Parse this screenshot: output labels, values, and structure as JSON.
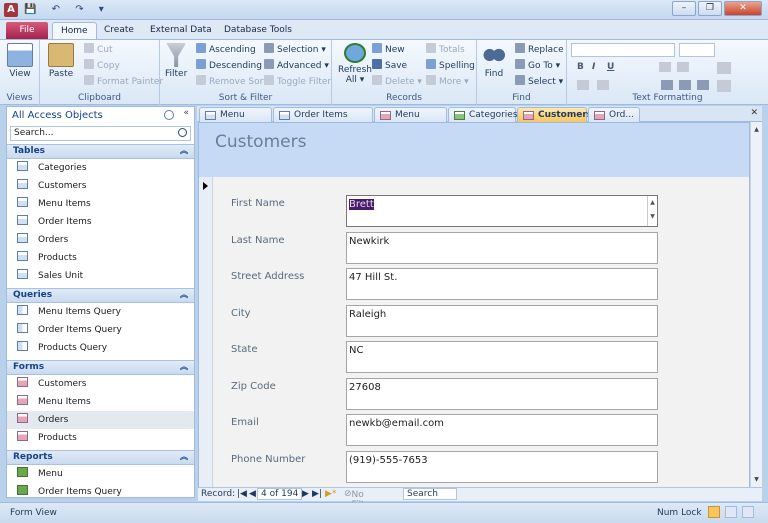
{
  "window": {
    "app_letter": "A",
    "quick_access": "💾 ↶ ↷ ▾",
    "controls": [
      "–",
      "❐",
      "✕"
    ]
  },
  "ribbon_tabs": {
    "file": "File",
    "tabs": [
      "Home",
      "Create",
      "External Data",
      "Database Tools"
    ]
  },
  "ribbon": {
    "views": {
      "view": "View",
      "group": "Views"
    },
    "clipboard": {
      "paste": "Paste",
      "cut": "Cut",
      "copy": "Copy",
      "format_painter": "Format Painter",
      "group": "Clipboard"
    },
    "sort_filter": {
      "filter": "Filter",
      "ascending": "Ascending",
      "descending": "Descending",
      "remove_sort": "Remove Sort",
      "selection": "Selection ▾",
      "advanced": "Advanced ▾",
      "toggle_filter": "Toggle Filter",
      "group": "Sort & Filter"
    },
    "records": {
      "refresh": "Refresh",
      "refresh_all": "All ▾",
      "new": "New",
      "save": "Save",
      "delete": "Delete ▾",
      "totals": "Totals",
      "spelling": "Spelling",
      "more": "More ▾",
      "group": "Records"
    },
    "find": {
      "find": "Find",
      "replace": "Replace",
      "go_to": "Go To ▾",
      "select": "Select ▾",
      "group": "Find"
    },
    "text_formatting": {
      "group": "Text Formatting",
      "bold": "B",
      "italic": "I",
      "underline": "U"
    }
  },
  "nav_pane": {
    "title": "All Access Objects",
    "search_placeholder": "Search...",
    "sections": [
      {
        "name": "Tables",
        "items": [
          "Categories",
          "Customers",
          "Menu Items",
          "Order Items",
          "Orders",
          "Products",
          "Sales Unit"
        ]
      },
      {
        "name": "Queries",
        "items": [
          "Menu Items Query",
          "Order Items Query",
          "Products Query"
        ]
      },
      {
        "name": "Forms",
        "items": [
          "Customers",
          "Menu Items",
          "Orders",
          "Products"
        ]
      },
      {
        "name": "Reports",
        "items": [
          "Menu",
          "Order Items Query"
        ]
      }
    ]
  },
  "doc_tabs": [
    "Menu Items",
    "Order Items Query",
    "Menu Items",
    "Categories",
    "Customers",
    "Ord..."
  ],
  "form": {
    "title": "Customers",
    "fields": [
      {
        "label": "First Name",
        "value": "Brett"
      },
      {
        "label": "Last Name",
        "value": "Newkirk"
      },
      {
        "label": "Street Address",
        "value": "47 Hill St."
      },
      {
        "label": "City",
        "value": "Raleigh"
      },
      {
        "label": "State",
        "value": "NC"
      },
      {
        "label": "Zip Code",
        "value": "27608"
      },
      {
        "label": "Email",
        "value": "newkb@email.com"
      },
      {
        "label": "Phone Number",
        "value": "(919)-555-7653"
      }
    ]
  },
  "record_nav": {
    "label": "Record:",
    "position": "4 of 194",
    "filter": "No Filter",
    "search": "Search"
  },
  "status_bar": {
    "view": "Form View",
    "num_lock": "Num Lock"
  },
  "colors": {
    "file_tab": "#a3214b",
    "active_tab": "#f7c65f",
    "form_header": "#c6daf6"
  }
}
